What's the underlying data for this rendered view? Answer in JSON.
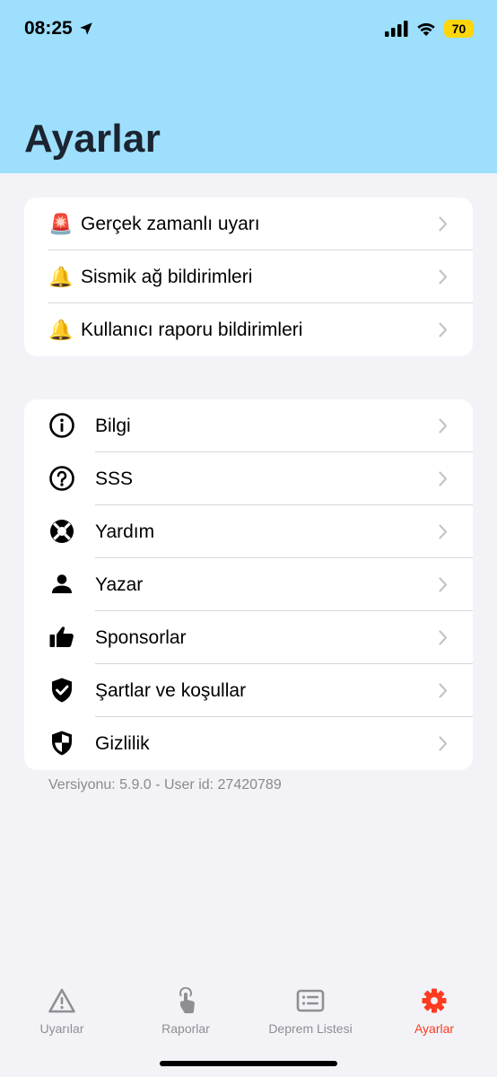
{
  "status_bar": {
    "time": "08:25",
    "battery": "70"
  },
  "header": {
    "title": "Ayarlar",
    "background_color": "#9ddffd"
  },
  "notifications_group": {
    "items": [
      {
        "emoji": "🚨",
        "label": "Gerçek zamanlı uyarı"
      },
      {
        "emoji": "🔔",
        "label": "Sismik ağ bildirimleri"
      },
      {
        "emoji": "🔔",
        "label": "Kullanıcı raporu bildirimleri"
      }
    ]
  },
  "info_group": {
    "items": [
      {
        "icon": "info-icon",
        "label": "Bilgi"
      },
      {
        "icon": "question-icon",
        "label": "SSS"
      },
      {
        "icon": "lifebuoy-icon",
        "label": "Yardım"
      },
      {
        "icon": "person-icon",
        "label": "Yazar"
      },
      {
        "icon": "thumbs-up-icon",
        "label": "Sponsorlar"
      },
      {
        "icon": "shield-check-icon",
        "label": "Şartlar ve koşullar"
      },
      {
        "icon": "shield-half-icon",
        "label": "Gizlilik"
      }
    ]
  },
  "version_text": "Versiyonu: 5.9.0 - User id: 27420789",
  "tabbar": {
    "tabs": [
      {
        "label": "Uyarılar",
        "icon": "warning-triangle-icon",
        "active": false
      },
      {
        "label": "Raporlar",
        "icon": "touch-hand-icon",
        "active": false
      },
      {
        "label": "Deprem Listesi",
        "icon": "list-icon",
        "active": false
      },
      {
        "label": "Ayarlar",
        "icon": "gear-icon",
        "active": true
      }
    ],
    "active_color": "#ff3b1f",
    "inactive_color": "#8e8e93"
  }
}
